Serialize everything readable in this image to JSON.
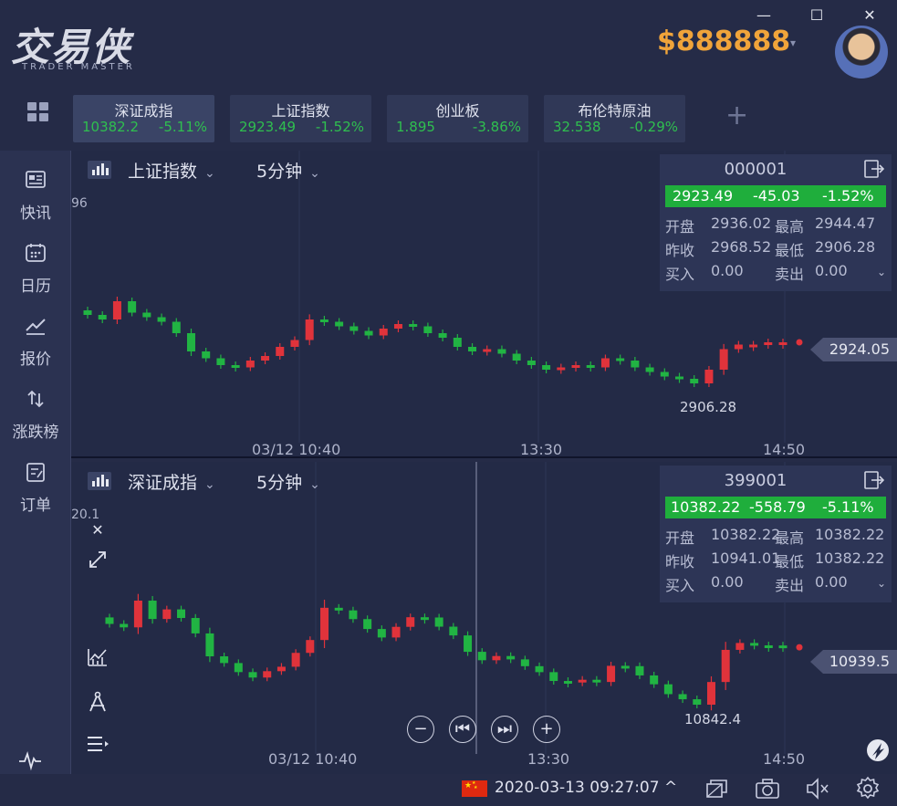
{
  "app": {
    "logo_cn": "交易侠",
    "logo_en": "TRADER MASTER",
    "balance": "$888888"
  },
  "window": {
    "minimize": "—",
    "maximize": "☐",
    "close": "✕"
  },
  "tickers": [
    {
      "name": "深证成指",
      "value": "10382.2",
      "pct": "-5.11%",
      "active": true
    },
    {
      "name": "上证指数",
      "value": "2923.49",
      "pct": "-1.52%",
      "active": false
    },
    {
      "name": "创业板",
      "value": "1.895",
      "pct": "-3.86%",
      "active": false
    },
    {
      "name": "布伦特原油",
      "value": "32.538",
      "pct": "-0.29%",
      "active": false
    }
  ],
  "sidebar": [
    {
      "label": "快讯",
      "icon": "news-icon"
    },
    {
      "label": "日历",
      "icon": "calendar-icon"
    },
    {
      "label": "报价",
      "icon": "quote-chart-icon"
    },
    {
      "label": "涨跌榜",
      "icon": "up-down-arrows-icon"
    },
    {
      "label": "订单",
      "icon": "order-icon"
    }
  ],
  "colors": {
    "up": "#e0333b",
    "down": "#21b443",
    "bg": "#232a46",
    "accent": "#f0a43a"
  },
  "panels": {
    "top": {
      "symbol": "上证指数",
      "period": "5分钟",
      "code": "000001",
      "price": "2923.49",
      "change": "-45.03",
      "change_pct": "-1.52%",
      "open_label": "开盘",
      "open": "2936.02",
      "high_label": "最高",
      "high": "2944.47",
      "prev_label": "昨收",
      "prev": "2968.52",
      "low_label": "最低",
      "low": "2906.28",
      "buy_label": "买入",
      "buy": "0.00",
      "sell_label": "卖出",
      "sell": "0.00",
      "last_tag": "2924.05",
      "low_marker": "2906.28",
      "clip_label": "96",
      "x_ticks": [
        "03/12 10:40",
        "13:30",
        "14:50"
      ]
    },
    "bottom": {
      "symbol": "深证成指",
      "period": "5分钟",
      "code": "399001",
      "price": "10382.22",
      "change": "-558.79",
      "change_pct": "-5.11%",
      "open_label": "开盘",
      "open": "10382.22",
      "high_label": "最高",
      "high": "10382.22",
      "prev_label": "昨收",
      "prev": "10941.01",
      "low_label": "最低",
      "low": "10382.22",
      "buy_label": "买入",
      "buy": "0.00",
      "sell_label": "卖出",
      "sell": "0.00",
      "last_tag": "10939.5",
      "low_marker": "10842.4",
      "clip_label": "20.1",
      "x_ticks": [
        "03/12 10:40",
        "13:30",
        "14:50"
      ]
    }
  },
  "chart_data": [
    {
      "type": "candlestick",
      "title": "上证指数",
      "period": "5分钟",
      "x_ticks": [
        "03/12 10:40",
        "13:30",
        "14:50"
      ],
      "last_price": 2924.05,
      "marked_low": 2906.28,
      "candles_close_trend": [
        2936,
        2934,
        2942,
        2937,
        2935,
        2933,
        2928,
        2920,
        2917,
        2914,
        2913,
        2916,
        2918,
        2922,
        2925,
        2934,
        2933,
        2931,
        2929,
        2927,
        2930,
        2932,
        2931,
        2928,
        2926,
        2922,
        2920,
        2921,
        2919,
        2916,
        2914,
        2912,
        2913,
        2914,
        2913,
        2917,
        2916,
        2913,
        2911,
        2909,
        2908,
        2906,
        2912,
        2921,
        2923,
        2923,
        2924,
        2924
      ]
    },
    {
      "type": "candlestick",
      "title": "深证成指",
      "period": "5分钟",
      "x_ticks": [
        "03/12 10:40",
        "13:30",
        "14:50"
      ],
      "last_price": 10939.5,
      "marked_low": 10842.4
    }
  ],
  "status": {
    "datetime": "2020-03-13 09:27:07 ^"
  }
}
